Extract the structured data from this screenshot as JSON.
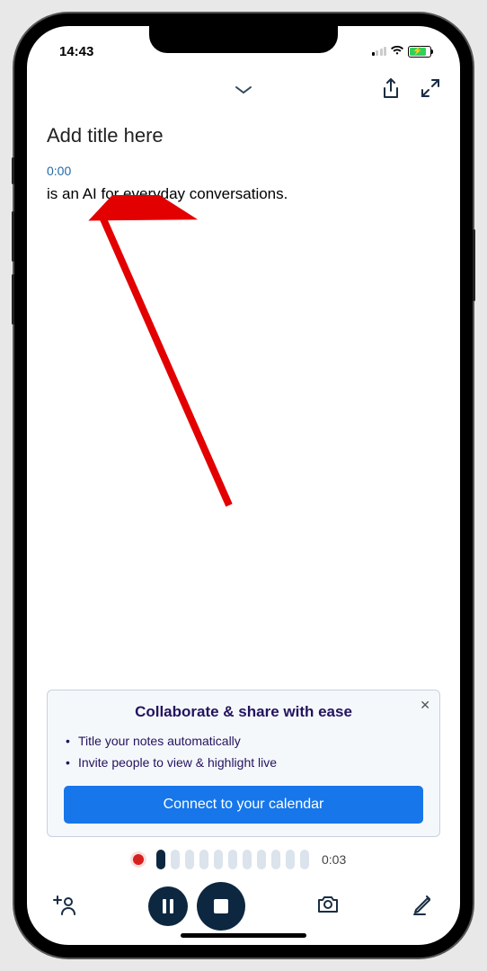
{
  "status_bar": {
    "time": "14:43"
  },
  "nav": {
    "title_placeholder": "Add title here",
    "timestamp": "0:00",
    "transcript_text": "is an AI for everyday conversations."
  },
  "promo": {
    "title": "Collaborate & share with ease",
    "bullets": [
      "Title your notes automatically",
      "Invite people to view & highlight live"
    ],
    "cta": "Connect to your calendar"
  },
  "recorder": {
    "elapsed": "0:03"
  }
}
